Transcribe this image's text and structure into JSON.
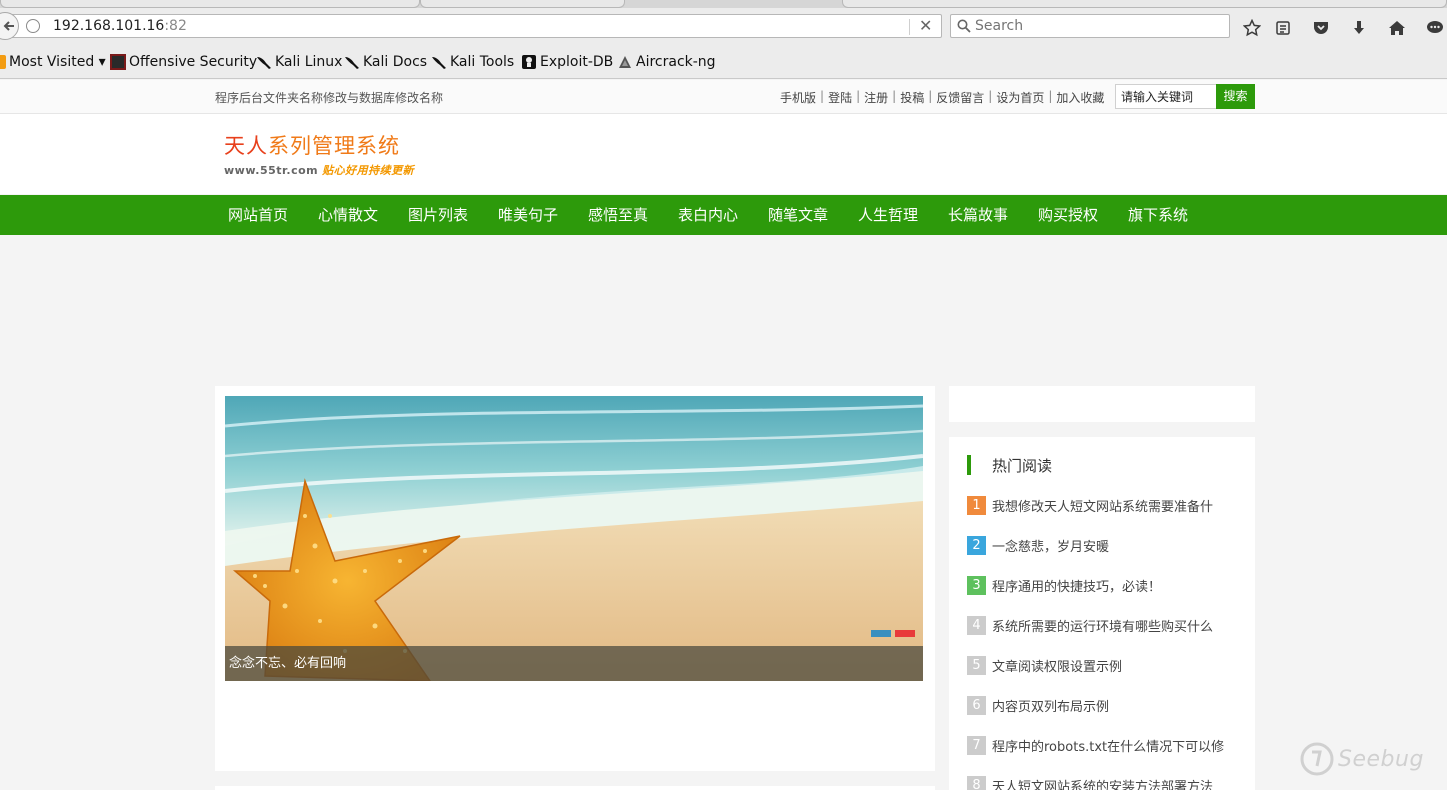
{
  "browser": {
    "url_host": "192.168.101.16",
    "url_port": ":82",
    "search_placeholder": "Search",
    "clear_glyph": "✕",
    "bookmarks": [
      {
        "label": "Most Visited ▾",
        "icon": "most-visited-icon"
      },
      {
        "label": "Offensive Security",
        "icon": "offsec-icon"
      },
      {
        "label": "Kali Linux",
        "icon": "kali-dragon-icon"
      },
      {
        "label": "Kali Docs",
        "icon": "kali-dragon-icon"
      },
      {
        "label": "Kali Tools",
        "icon": "kali-dragon-icon"
      },
      {
        "label": "Exploit-DB",
        "icon": "exploit-db-icon"
      },
      {
        "label": "Aircrack-ng",
        "icon": "aircrack-icon"
      }
    ]
  },
  "site": {
    "top_note": "程序后台文件夹名称修改与数据库修改名称",
    "top_links": [
      "手机版",
      "登陆",
      "注册",
      "投稿",
      "反馈留言",
      "设为首页",
      "加入收藏"
    ],
    "top_link_separator": "|",
    "search_value": "请输入关键词",
    "search_button": "搜索",
    "logo_title_part1": "天人",
    "logo_title_part2": "系列管理系统",
    "logo_domain": "www.55tr.com",
    "logo_slogan": "贴心好用持续更新",
    "nav": [
      "网站首页",
      "心情散文",
      "图片列表",
      "唯美句子",
      "感悟至真",
      "表白内心",
      "随笔文章",
      "人生哲理",
      "长篇故事",
      "购买授权",
      "旗下系统"
    ],
    "slider_caption": "念念不忘、必有回响",
    "hot_title": "热门阅读",
    "hot_list": [
      {
        "num": "1",
        "title": "我想修改天人短文网站系统需要准备什",
        "color": "#f08a3c"
      },
      {
        "num": "2",
        "title": "一念慈悲，岁月安暖",
        "color": "#3aa6dd"
      },
      {
        "num": "3",
        "title": "程序通用的快捷技巧，必读！",
        "color": "#5ec15e"
      },
      {
        "num": "4",
        "title": "系统所需要的运行环境有哪些购买什么",
        "color": "#cccccc"
      },
      {
        "num": "5",
        "title": "文章阅读权限设置示例",
        "color": "#cccccc"
      },
      {
        "num": "6",
        "title": "内容页双列布局示例",
        "color": "#cccccc"
      },
      {
        "num": "7",
        "title": "程序中的robots.txt在什么情况下可以修",
        "color": "#cccccc"
      },
      {
        "num": "8",
        "title": "天人短文网站系统的安装方法部署方法",
        "color": "#cccccc"
      }
    ]
  },
  "watermark": "Seebug",
  "colors": {
    "brand_green": "#2d9a0b",
    "logo_red": "#e8401c",
    "logo_orange": "#f07a18",
    "slider_dot_active": "#e83a3a",
    "slider_dot_inactive": "#3a8fbf"
  }
}
